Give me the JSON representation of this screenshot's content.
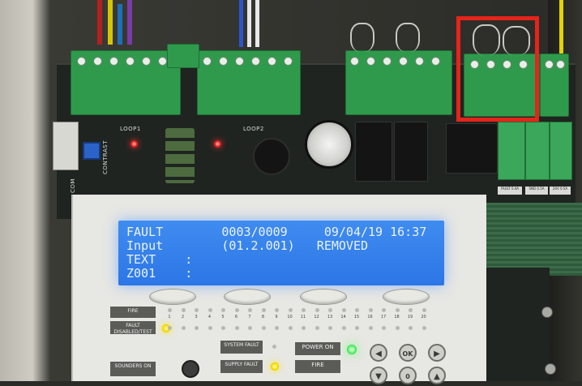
{
  "pcb": {
    "loop1_label": "LOOP1",
    "loop2_label": "LOOP2",
    "contrast_label": "CONTRAST",
    "com_label": "COM",
    "fuse_labels": [
      "FAULT 0.4A",
      "SND 0.5A",
      "24V 0.5A"
    ]
  },
  "lcd": {
    "line1": "FAULT        0003/0009     09/04/19 16:37",
    "line2": "Input        (01.2.001)   REMOVED",
    "line3": "TEXT    :",
    "line4": "Z001    :"
  },
  "panel": {
    "fire_label": "FIRE",
    "fault_label": "FAULT DISABLED/TEST",
    "sounders_label": "SOUNDERS ON",
    "system_fault_label": "SYSTEM FAULT",
    "supply_fault_label": "SUPPLY FAULT",
    "power_on_label": "POWER ON",
    "fire_indicator_label": "FIRE",
    "ok_label": "OK",
    "zero_label": "0",
    "zone_numbers": [
      "1",
      "2",
      "3",
      "4",
      "5",
      "6",
      "7",
      "8",
      "9",
      "10",
      "11",
      "12",
      "13",
      "14",
      "15",
      "16",
      "17",
      "18",
      "19",
      "20"
    ]
  },
  "colors": {
    "lcd_background": "#3f8cf0",
    "highlight_box": "#e5241b",
    "terminal_green": "#2f9a4c"
  }
}
